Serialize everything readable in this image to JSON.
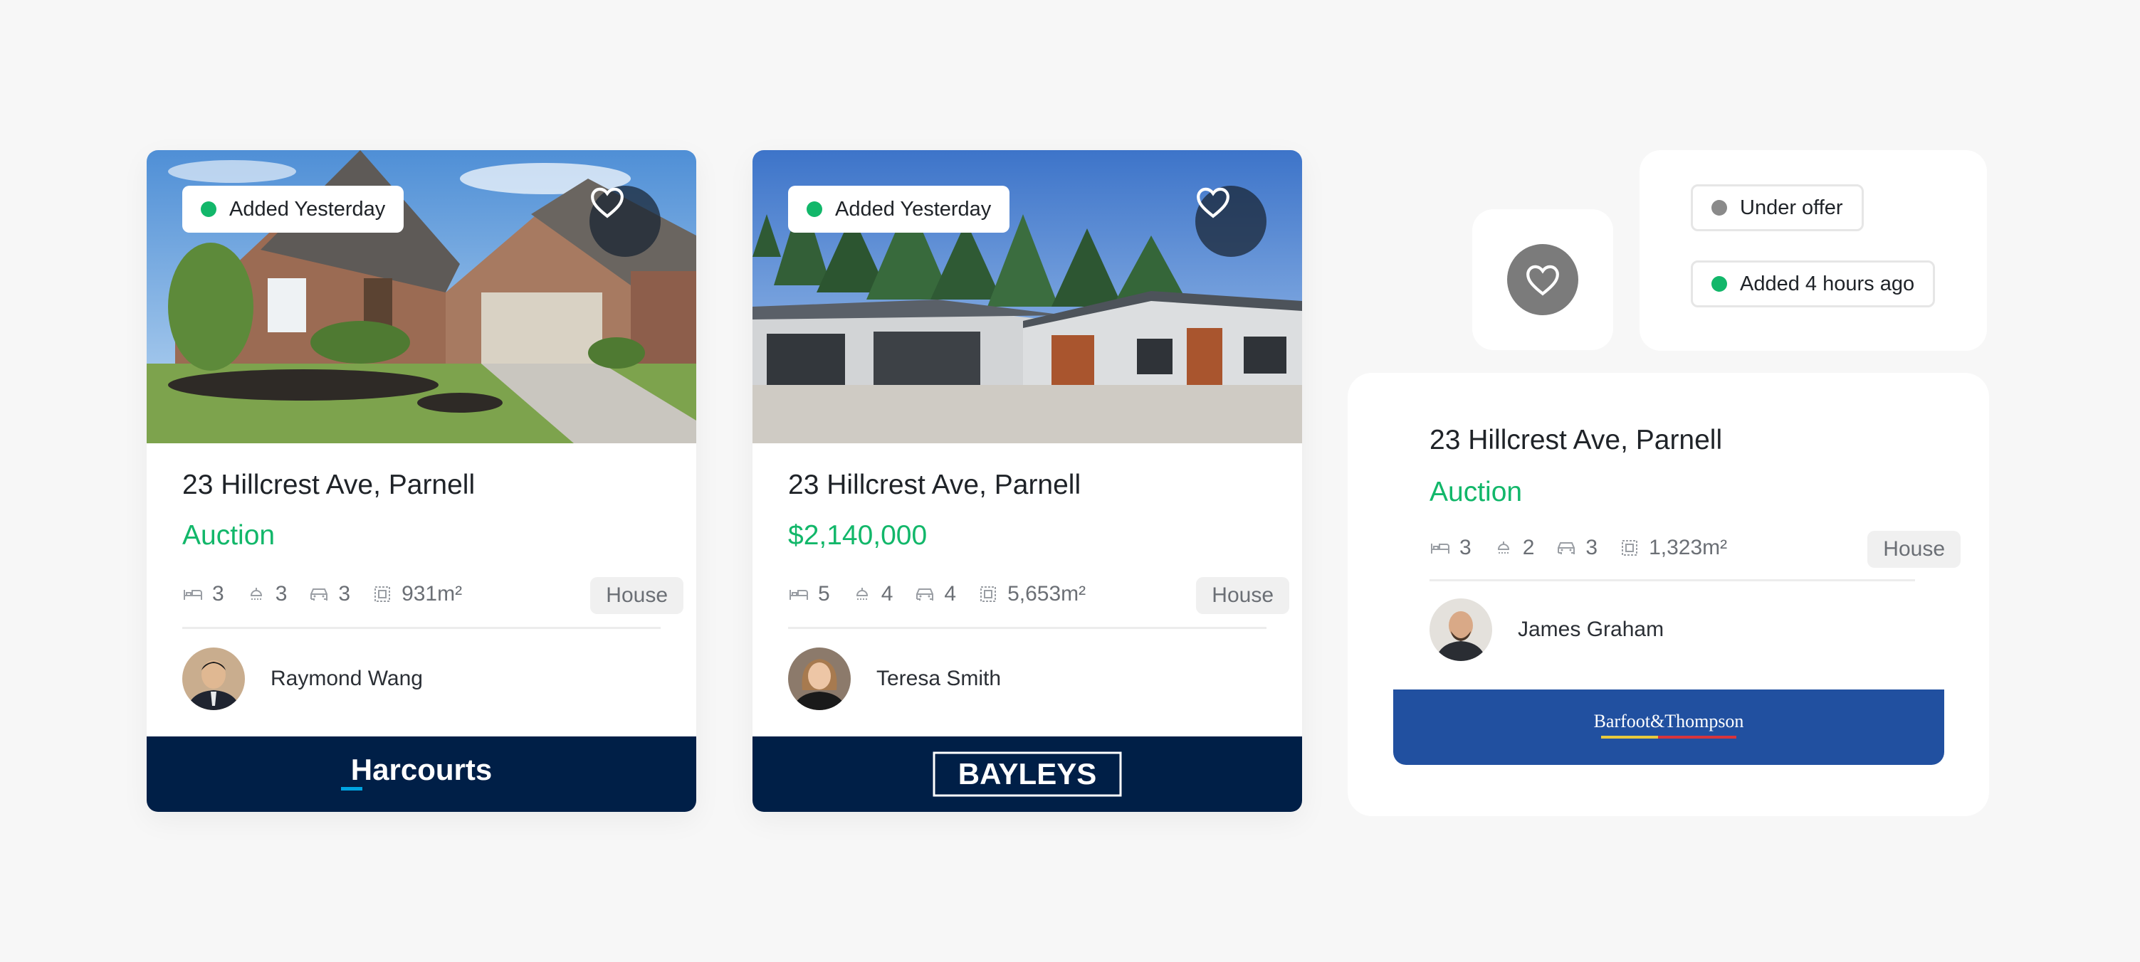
{
  "cards": [
    {
      "badge": "Added Yesterday",
      "address": "23 Hillcrest Ave, Parnell",
      "price": "Auction",
      "specs": {
        "beds": "3",
        "baths": "3",
        "cars": "3",
        "area": "931m²"
      },
      "type": "House",
      "agent": "Raymond Wang",
      "brand": "Harcourts"
    },
    {
      "badge": "Added Yesterday",
      "address": "23 Hillcrest Ave, Parnell",
      "price": "$2,140,000",
      "specs": {
        "beds": "5",
        "baths": "4",
        "cars": "4",
        "area": "5,653m²"
      },
      "type": "House",
      "agent": "Teresa Smith",
      "brand": "BAYLEYS"
    },
    {
      "address": "23 Hillcrest Ave, Parnell",
      "price": "Auction",
      "specs": {
        "beds": "3",
        "baths": "2",
        "cars": "3",
        "area": "1,323m²"
      },
      "type": "House",
      "agent": "James Graham",
      "brand": "Barfoot&Thompson"
    }
  ],
  "badges": {
    "under_offer": "Under offer",
    "added_recent": "Added 4 hours ago"
  },
  "icons": {
    "favorite": "heart-icon",
    "beds": "bed-icon",
    "baths": "shower-icon",
    "cars": "car-icon",
    "area": "floor-area-icon"
  },
  "colors": {
    "accent_green": "#12b76a",
    "status_grey": "#8a8a8a",
    "harcourts_navy": "#001f47",
    "bayleys_navy": "#001f47",
    "barfoot_blue": "#2150a0"
  }
}
